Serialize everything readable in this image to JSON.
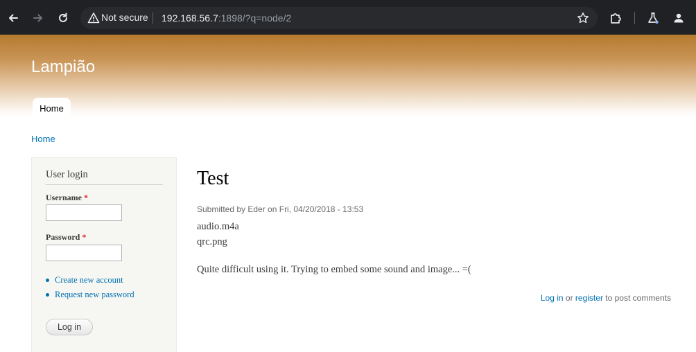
{
  "browser": {
    "not_secure_label": "Not secure",
    "url_host": "192.168.56.7",
    "url_rest": ":1898/?q=node/2",
    "icons": {
      "back": "back-arrow-icon",
      "forward": "forward-arrow-icon",
      "reload": "reload-icon",
      "warning": "warning-icon",
      "bookmark": "star-icon",
      "extensions": "puzzle-icon",
      "labs": "flask-icon",
      "profile": "person-icon"
    }
  },
  "site": {
    "name": "Lampião",
    "tabs": [
      {
        "label": "Home"
      }
    ]
  },
  "breadcrumb": {
    "home": "Home"
  },
  "sidebar": {
    "title": "User login",
    "username_label": "Username",
    "password_label": "Password",
    "required_mark": "*",
    "links": [
      "Create new account",
      "Request new password"
    ],
    "login_button": "Log in"
  },
  "node": {
    "title": "Test",
    "submitted": "Submitted by Eder on Fri, 04/20/2018 - 13:53",
    "attachments": [
      "audio.m4a",
      "qrc.png"
    ],
    "body": "Quite difficult using it. Trying to embed some sound and image... =(",
    "comment": {
      "login": "Log in",
      "or": "or",
      "register": "register",
      "suffix": "to post comments"
    }
  },
  "colors": {
    "link": "#0071b3",
    "header_top": "#b47a2e",
    "chrome_bg": "#202124",
    "required": "#e0252b"
  }
}
